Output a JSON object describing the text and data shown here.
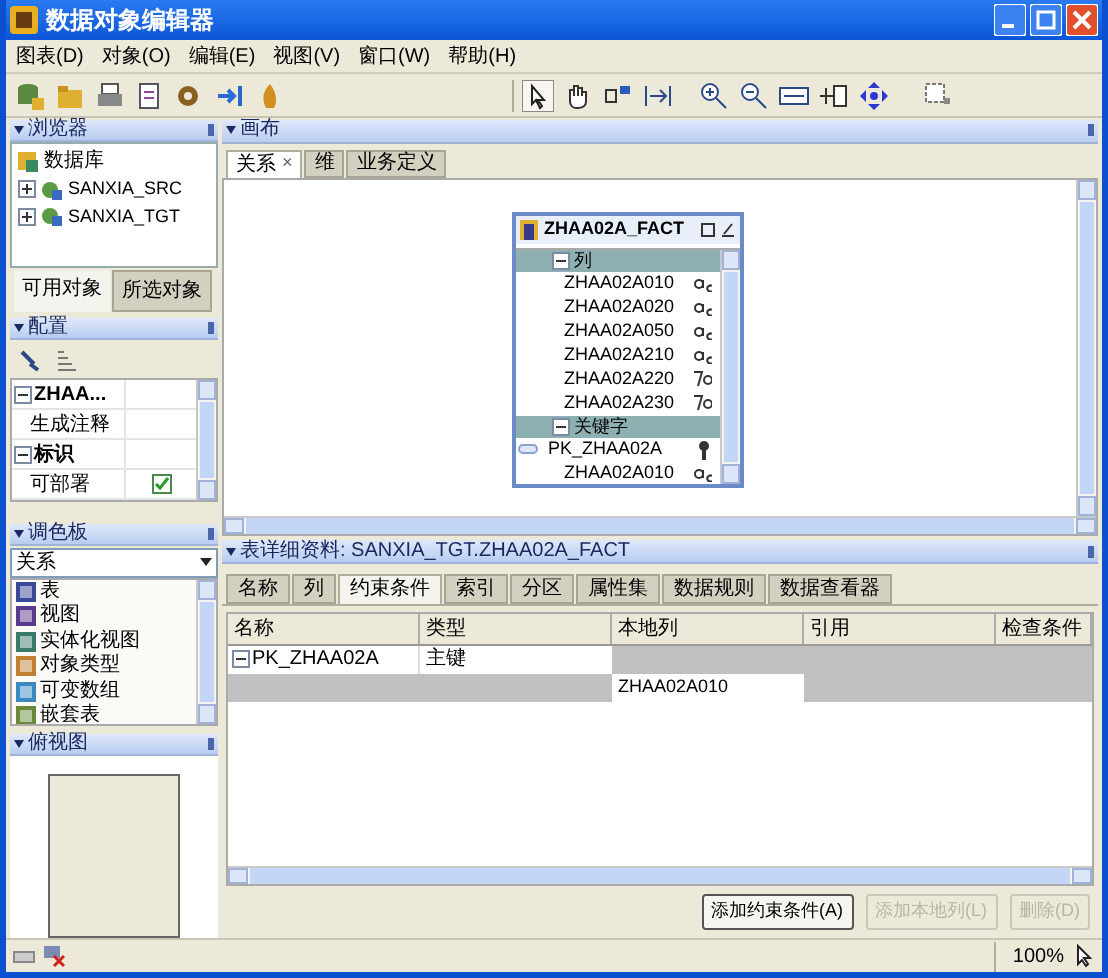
{
  "window": {
    "title": "数据对象编辑器"
  },
  "menu": [
    "图表(D)",
    "对象(O)",
    "编辑(E)",
    "视图(V)",
    "窗口(W)",
    "帮助(H)"
  ],
  "browser": {
    "title": "浏览器",
    "tree": [
      {
        "label": "数据库",
        "children": [
          {
            "label": "SANXIA_SRC",
            "expanded": false
          },
          {
            "label": "SANXIA_TGT",
            "expanded": false
          }
        ]
      }
    ],
    "tabs": [
      {
        "label": "可用对象",
        "selected": true
      },
      {
        "label": "所选对象",
        "selected": false
      }
    ]
  },
  "config": {
    "title": "配置",
    "rows": [
      {
        "kind": "group",
        "name": "ZHAA...",
        "expanded": true
      },
      {
        "kind": "property",
        "name": "生成注释"
      },
      {
        "kind": "group",
        "name": "标识",
        "expanded": true
      },
      {
        "kind": "checkbox",
        "name": "可部署",
        "checked": true
      }
    ]
  },
  "palette": {
    "title": "调色板",
    "dropdown": "关系",
    "items": [
      "表",
      "视图",
      "实体化视图",
      "对象类型",
      "可变数组",
      "嵌套表"
    ]
  },
  "overview": {
    "title": "俯视图"
  },
  "canvas": {
    "title": "画布",
    "tabs": [
      {
        "label": "关系",
        "selected": true,
        "close": "×"
      },
      {
        "label": "维",
        "selected": false
      },
      {
        "label": "业务定义",
        "selected": false
      }
    ],
    "entity": {
      "name": "ZHAA02A_FACT",
      "sections": [
        {
          "label": "列",
          "expanded": true,
          "rows": [
            {
              "name": "ZHAA02A010",
              "kind": "text"
            },
            {
              "name": "ZHAA02A020",
              "kind": "text"
            },
            {
              "name": "ZHAA02A050",
              "kind": "text"
            },
            {
              "name": "ZHAA02A210",
              "kind": "text"
            },
            {
              "name": "ZHAA02A220",
              "kind": "number"
            },
            {
              "name": "ZHAA02A230",
              "kind": "number"
            }
          ]
        },
        {
          "label": "关键字",
          "expanded": true,
          "rows": [
            {
              "name": "PK_ZHAA02A",
              "kind": "key"
            },
            {
              "name": "ZHAA02A010",
              "kind": "text"
            }
          ]
        }
      ]
    }
  },
  "details": {
    "title": "表详细资料: SANXIA_TGT.ZHAA02A_FACT",
    "tabs": [
      {
        "label": "名称",
        "selected": false
      },
      {
        "label": "列",
        "selected": false
      },
      {
        "label": "约束条件",
        "selected": true
      },
      {
        "label": "索引",
        "selected": false
      },
      {
        "label": "分区",
        "selected": false
      },
      {
        "label": "属性集",
        "selected": false
      },
      {
        "label": "数据规则",
        "selected": false
      },
      {
        "label": "数据查看器",
        "selected": false
      }
    ],
    "columns": [
      "名称",
      "类型",
      "本地列",
      "引用",
      "检查条件"
    ],
    "constraints": [
      {
        "name": "PK_ZHAA02A",
        "type": "主键",
        "expanded": true,
        "local_columns": [
          "ZHAA02A010"
        ]
      }
    ],
    "buttons": [
      {
        "label": "添加约束条件(A)",
        "disabled": false
      },
      {
        "label": "添加本地列(L)",
        "disabled": true
      },
      {
        "label": "删除(D)",
        "disabled": true
      }
    ]
  },
  "status_bar": {
    "zoom": "100%"
  }
}
